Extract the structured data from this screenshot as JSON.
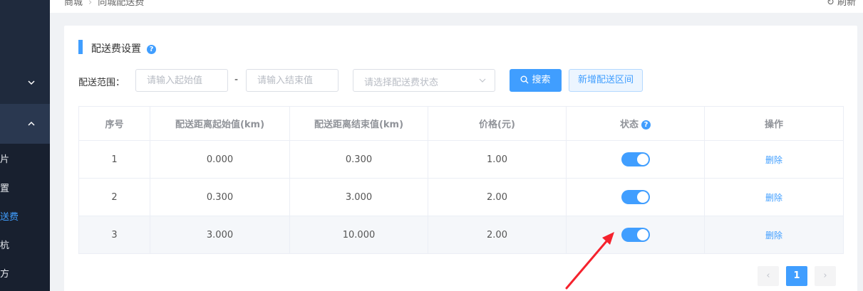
{
  "sidebar": {
    "items": [
      {
        "label": "片",
        "active": false
      },
      {
        "label": "置",
        "active": false
      },
      {
        "label": "送费",
        "active": true
      },
      {
        "label": "杭",
        "active": false
      },
      {
        "label": "方",
        "active": false
      }
    ]
  },
  "topbar": {
    "breadcrumb": [
      "商城",
      "同城配送费"
    ],
    "refresh_label": "刷新"
  },
  "card": {
    "title": "配送费设置",
    "help": "?"
  },
  "filter": {
    "label": "配送范围：",
    "start_placeholder": "请输入起始值",
    "separator": "-",
    "end_placeholder": "请输入结束值",
    "status_placeholder": "请选择配送费状态",
    "search_label": "搜索",
    "add_label": "新增配送区间"
  },
  "table": {
    "columns": [
      "序号",
      "配送距离起始值(km)",
      "配送距离结束值(km)",
      "价格(元)",
      "状态",
      "操作"
    ],
    "rows": [
      {
        "index": "1",
        "start": "0.000",
        "end": "0.300",
        "price": "1.00",
        "enabled": true,
        "action": "删除"
      },
      {
        "index": "2",
        "start": "0.300",
        "end": "3.000",
        "price": "2.00",
        "enabled": true,
        "action": "删除"
      },
      {
        "index": "3",
        "start": "3.000",
        "end": "10.000",
        "price": "2.00",
        "enabled": true,
        "action": "删除"
      }
    ]
  },
  "pagination": {
    "prev": "‹",
    "current": "1",
    "next": "›"
  },
  "colors": {
    "primary": "#409eff",
    "sidebar_bg": "#1f2a3d",
    "annotation_arrow": "#f5222d"
  }
}
